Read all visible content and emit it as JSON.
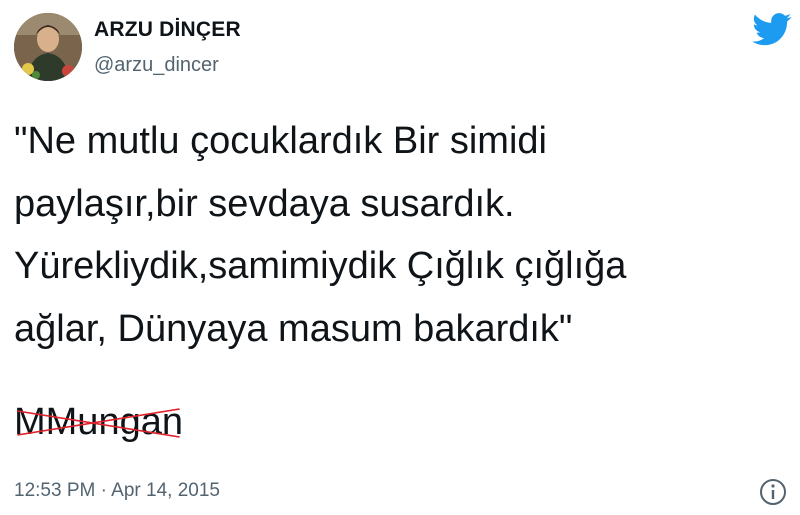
{
  "author": {
    "display_name": "ARZU DİNÇER",
    "handle": "@arzu_dincer",
    "avatar_icon": "profile-photo"
  },
  "brand": {
    "icon": "twitter-bird-icon",
    "color": "#1d9bf0"
  },
  "tweet": {
    "lines": [
      "\"Ne mutlu çocuklardık Bir simidi",
      "paylaşır,bir sevdaya susardık.",
      "Yürekliydik,samimiydik Çığlık çığlığa",
      "ağlar, Dünyaya masum bakardık\""
    ],
    "struck_attribution": "MMungan",
    "strike_color": "#e0222a"
  },
  "meta": {
    "time": "12:53 PM",
    "separator": "·",
    "date": "Apr 14, 2015",
    "info_icon": "info-icon"
  }
}
